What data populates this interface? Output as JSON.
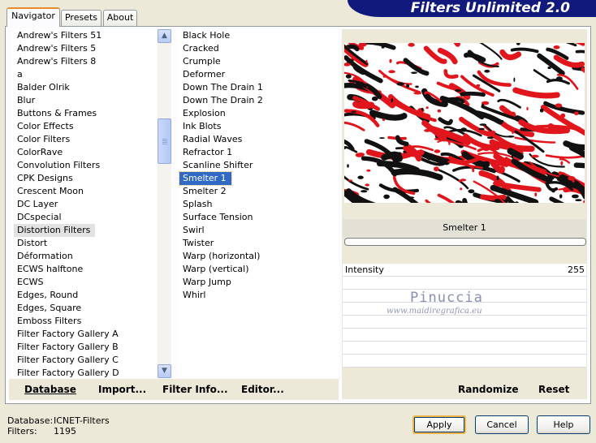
{
  "app": {
    "title": "Filters Unlimited 2.0"
  },
  "tabs": [
    {
      "label": "Navigator",
      "active": true
    },
    {
      "label": "Presets",
      "active": false
    },
    {
      "label": "About",
      "active": false
    }
  ],
  "categories": {
    "items": [
      "Andrew's Filters 51",
      "Andrew's Filters 5",
      "Andrew's Filters 8",
      "a",
      "Balder Olrik",
      "Blur",
      "Buttons & Frames",
      "Color Effects",
      "Color Filters",
      "ColorRave",
      "Convolution Filters",
      "CPK Designs",
      "Crescent Moon",
      "DC Layer",
      "DCspecial",
      "Distortion Filters",
      "Distort",
      "Déformation",
      "ECWS halftone",
      "ECWS",
      "Edges, Round",
      "Edges, Square",
      "Emboss Filters",
      "Filter Factory Gallery A",
      "Filter Factory Gallery B",
      "Filter Factory Gallery C",
      "Filter Factory Gallery D"
    ],
    "selected": "Distortion Filters"
  },
  "filters": {
    "items": [
      "Black Hole",
      "Cracked",
      "Crumple",
      "Deformer",
      "Down The Drain 1",
      "Down The Drain 2",
      "Explosion",
      "Ink Blots",
      "Radial Waves",
      "Refractor 1",
      "Scanline Shifter",
      "Smelter 1",
      "Smelter 2",
      "Splash",
      "Surface Tension",
      "Swirl",
      "Twister",
      "Warp (horizontal)",
      "Warp (vertical)",
      "Warp Jump",
      "Whirl"
    ],
    "selected": "Smelter 1"
  },
  "left_buttons": {
    "database": "Database",
    "import": "Import...",
    "filter_info": "Filter Info...",
    "editor": "Editor..."
  },
  "preview": {
    "filter_name": "Smelter 1",
    "progress": 0
  },
  "params": [
    {
      "label": "Intensity",
      "value": "255"
    }
  ],
  "watermark": {
    "name": "Pinuccia",
    "url": "www.maidiregrafica.eu"
  },
  "right_buttons": {
    "randomize": "Randomize",
    "reset": "Reset"
  },
  "status": {
    "database_label": "Database:",
    "database_value": "ICNET-Filters",
    "filters_label": "Filters:",
    "filters_value": "1195"
  },
  "dialog_buttons": {
    "apply": "Apply",
    "cancel": "Cancel",
    "help": "Help"
  },
  "colors": {
    "banner": "#12197c",
    "selection": "#316ac5",
    "preview_red": "#e0161c",
    "preview_black": "#111111"
  }
}
